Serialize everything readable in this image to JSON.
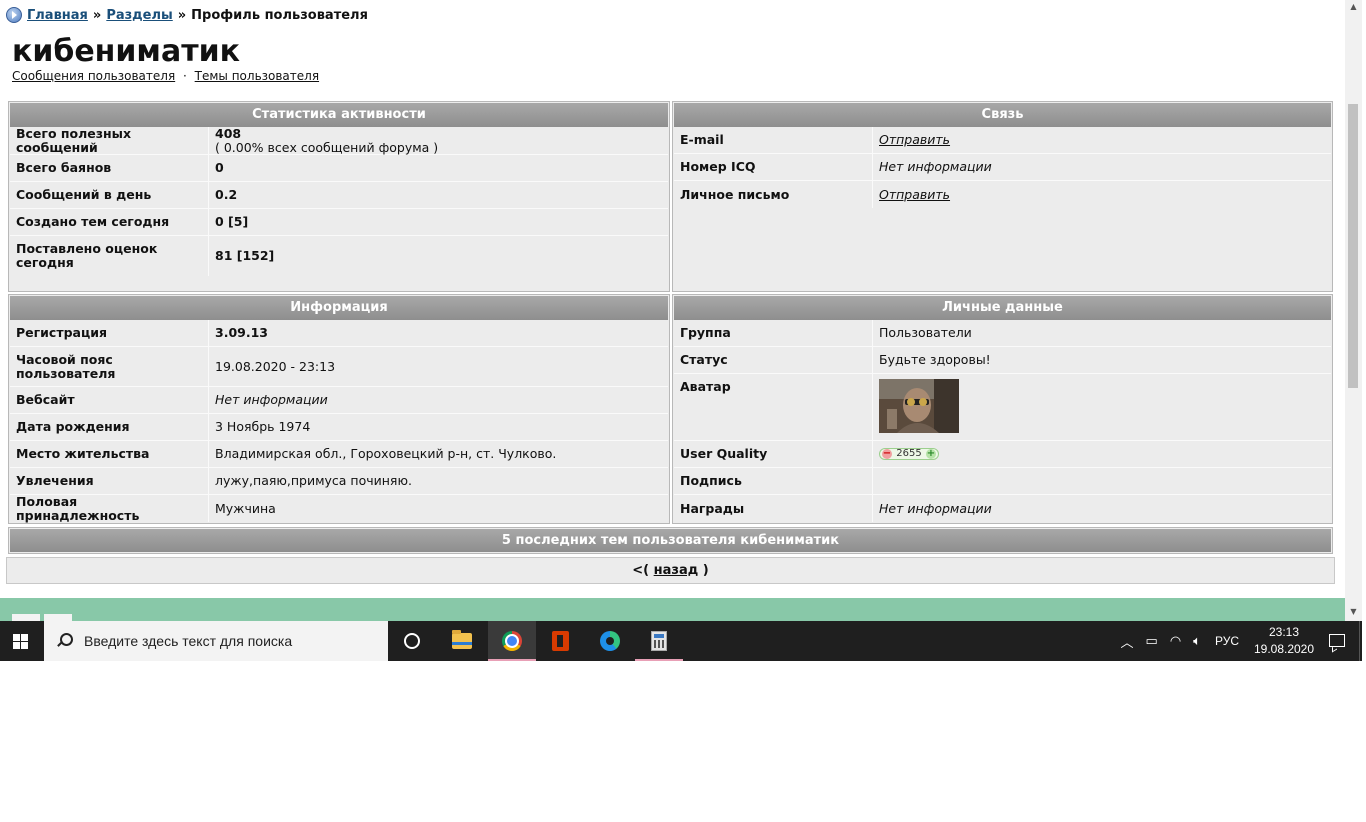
{
  "breadcrumb": {
    "home": "Главная",
    "sep1": "»",
    "sections": "Разделы",
    "sep2": "»",
    "current": "Профиль пользователя"
  },
  "profile": {
    "username": "кибениматик",
    "links": {
      "messages": "Сообщения пользователя",
      "dot": "·",
      "topics": "Темы пользователя"
    }
  },
  "activity": {
    "title": "Статистика активности",
    "rows": [
      {
        "label": "Всего полезных сообщений",
        "value": "408",
        "sub": "( 0.00% всех сообщений форума )"
      },
      {
        "label": "Всего баянов",
        "value": "0"
      },
      {
        "label": "Сообщений в день",
        "value": "0.2"
      },
      {
        "label": "Создано тем сегодня",
        "value": "0 [5]"
      },
      {
        "label": "Поставлено оценок сегодня",
        "value": "81 [152]"
      }
    ]
  },
  "contact": {
    "title": "Связь",
    "rows": [
      {
        "label": "E-mail",
        "value": "Отправить"
      },
      {
        "label": "Номер ICQ",
        "value": "Нет информации"
      },
      {
        "label": "Личное письмо",
        "value": "Отправить"
      }
    ]
  },
  "info": {
    "title": "Информация",
    "rows": [
      {
        "label": "Регистрация",
        "value": "3.09.13"
      },
      {
        "label": "Часовой пояс пользователя",
        "value": "19.08.2020 - 23:13"
      },
      {
        "label": "Вебсайт",
        "value": "Нет информации"
      },
      {
        "label": "Дата рождения",
        "value": "3 Ноябрь 1974"
      },
      {
        "label": "Место жительства",
        "value": "Владимирская обл., Гороховецкий р-н, ст. Чулково."
      },
      {
        "label": "Увлечения",
        "value": "лужу,паяю,примуса починяю."
      },
      {
        "label": "Половая принадлежность",
        "value": "Мужчина"
      }
    ]
  },
  "personal": {
    "title": "Личные данные",
    "rows": [
      {
        "label": "Группа",
        "value": "Пользователи"
      },
      {
        "label": "Статус",
        "value": "Будьте здоровы!"
      },
      {
        "label": "Аватар"
      },
      {
        "label": "User Quality",
        "value": "2655",
        "minus": "−",
        "plus": "+"
      },
      {
        "label": "Подпись",
        "value": ""
      },
      {
        "label": "Награды",
        "value": "Нет информации"
      }
    ]
  },
  "recent": {
    "title": "5 последних тем пользователя кибениматик"
  },
  "back": {
    "open": "<(",
    "link": "назад",
    "close": ")"
  },
  "taskbar": {
    "search_placeholder": "Введите здесь текст для поиска",
    "lang": "РУС",
    "time": "23:13",
    "date": "19.08.2020",
    "icons": [
      "windows-start-icon",
      "search-icon",
      "task-view-icon",
      "file-explorer-icon",
      "chrome-icon",
      "office-icon",
      "edge-icon",
      "calculator-icon"
    ]
  },
  "colors": {
    "panel_header": "#999999",
    "link": "#1a4f7a",
    "footer_band": "#88c8a8",
    "taskbar": "#1f1f1f"
  }
}
